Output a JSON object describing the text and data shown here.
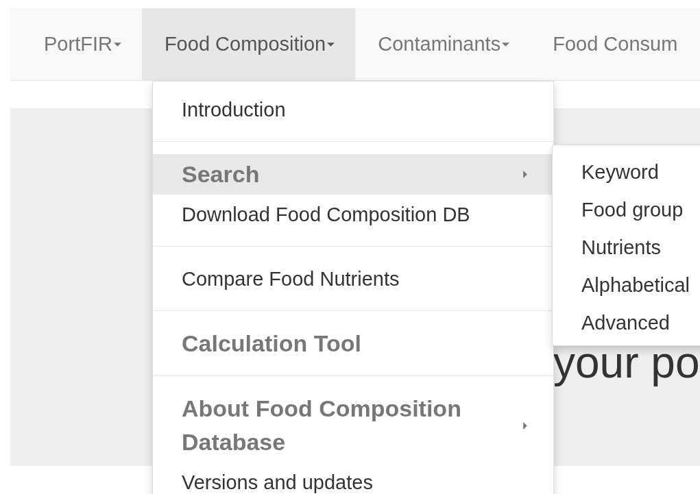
{
  "navbar": {
    "items": [
      {
        "label": "PortFIR",
        "caret": true,
        "selected": false
      },
      {
        "label": "Food Composition",
        "caret": true,
        "selected": true
      },
      {
        "label": "Contaminants",
        "caret": true,
        "selected": false
      },
      {
        "label": "Food Consum",
        "caret": false,
        "selected": false
      }
    ]
  },
  "dropdown": {
    "items": [
      {
        "kind": "link",
        "label": "Introduction"
      },
      {
        "kind": "divider"
      },
      {
        "kind": "header",
        "label": "Search",
        "highlighted": true,
        "submenu": true
      },
      {
        "kind": "link",
        "label": "Download Food Composition DB"
      },
      {
        "kind": "divider"
      },
      {
        "kind": "link",
        "label": "Compare Food Nutrients"
      },
      {
        "kind": "divider"
      },
      {
        "kind": "header",
        "label": "Calculation Tool",
        "highlighted": false,
        "submenu": false
      },
      {
        "kind": "divider"
      },
      {
        "kind": "header",
        "label": "About Food Composition Database",
        "highlighted": false,
        "submenu": true
      },
      {
        "kind": "link",
        "label": "Versions and updates"
      }
    ]
  },
  "submenu": {
    "items": [
      "Keyword",
      "Food group",
      "Nutrients",
      "Alphabetical",
      "Advanced"
    ]
  },
  "jumbotron": {
    "text": "your po"
  }
}
